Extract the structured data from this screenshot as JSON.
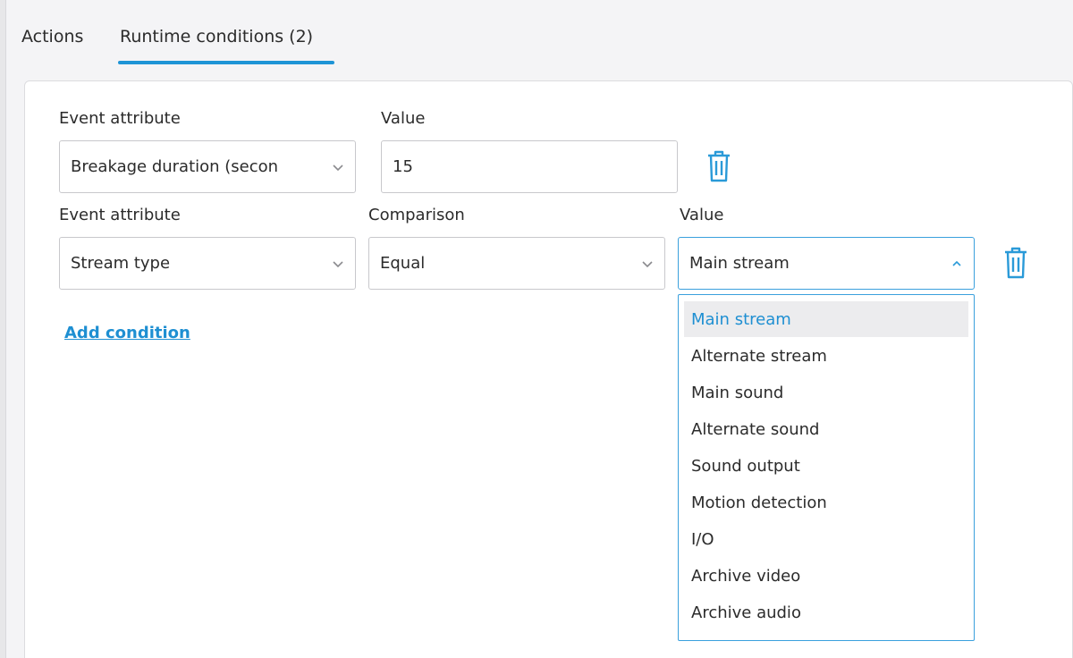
{
  "tabs": [
    {
      "label": "Actions"
    },
    {
      "label": "Runtime conditions (2)"
    }
  ],
  "row1": {
    "attribute_label": "Event attribute",
    "value_label": "Value",
    "attribute_value": "Breakage duration (secon",
    "value": "15"
  },
  "row2": {
    "attribute_label": "Event attribute",
    "comparison_label": "Comparison",
    "value_label": "Value",
    "attribute_value": "Stream type",
    "comparison_value": "Equal",
    "value": "Main stream"
  },
  "add_condition": "Add condition",
  "dropdown": {
    "selected": "Main stream",
    "options": [
      "Main stream",
      "Alternate stream",
      "Main sound",
      "Alternate sound",
      "Sound output",
      "Motion detection",
      "I/O",
      "Archive video",
      "Archive audio"
    ]
  },
  "colors": {
    "accent": "#1e94d6",
    "link": "#1e8fd2",
    "icon": "#2a9ad8",
    "selected_bg": "#ececee"
  }
}
